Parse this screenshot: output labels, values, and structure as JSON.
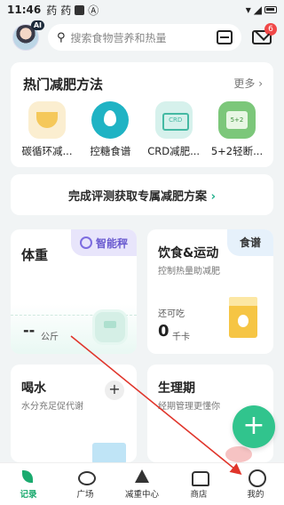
{
  "statusbar": {
    "time": "11:46",
    "app_icons": [
      "药",
      "药"
    ]
  },
  "header": {
    "ai_badge": "AI",
    "search_placeholder": "搜索食物营养和热量",
    "mail_count": "6"
  },
  "methods": {
    "title": "热门减肥方法",
    "more": "更多 ›",
    "items": [
      {
        "label": "碳循环减..."
      },
      {
        "label": "控糖食谱"
      },
      {
        "label": "CRD减肥..."
      },
      {
        "label": "5+2轻断..."
      }
    ]
  },
  "assess": {
    "text": "完成评测获取专属减肥方案",
    "chevron": "›"
  },
  "weight": {
    "title": "体重",
    "scale": "智能秤",
    "value": "--",
    "unit": "公斤"
  },
  "food": {
    "title": "饮食&运动",
    "subtitle": "控制热量助减肥",
    "recipe": "食谱",
    "cal_label": "还可吃",
    "cal_value": "0",
    "cal_unit": "千卡"
  },
  "water": {
    "title": "喝水",
    "subtitle": "水分充足促代谢",
    "plus": "+"
  },
  "period": {
    "title": "生理期",
    "subtitle": "经期管理更懂你"
  },
  "fab": {
    "label": "+"
  },
  "tabs": [
    {
      "label": "记录"
    },
    {
      "label": "广场"
    },
    {
      "label": "减重中心"
    },
    {
      "label": "商店"
    },
    {
      "label": "我的"
    }
  ],
  "colors": {
    "accent": "#1aaa6e",
    "fab": "#31c48d",
    "arrow": "#e0352b"
  }
}
